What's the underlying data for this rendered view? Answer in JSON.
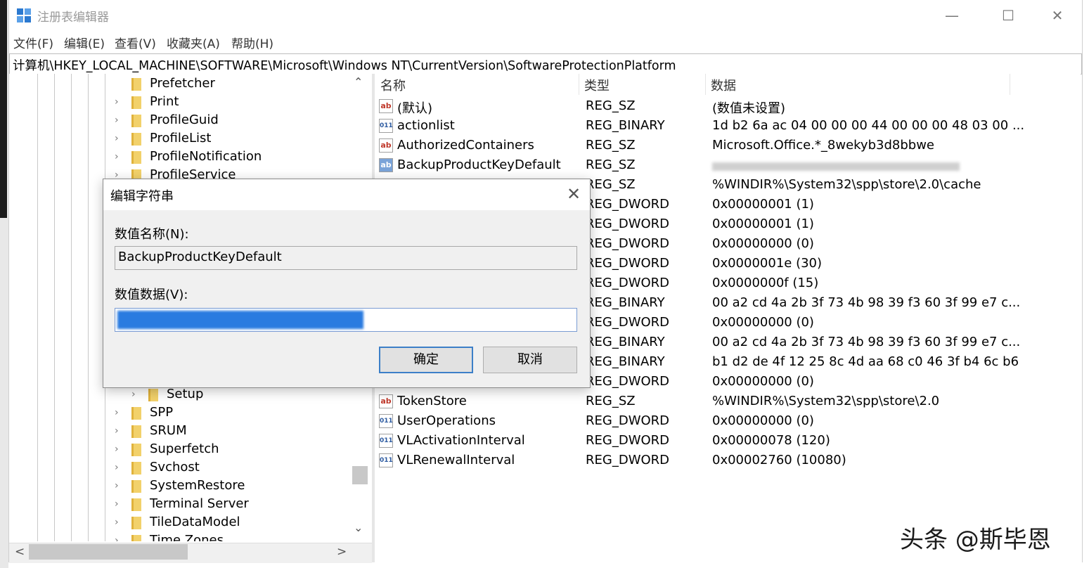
{
  "window": {
    "title": "注册表编辑器",
    "minimize_glyph": "—",
    "maximize_glyph": "☐",
    "close_glyph": "✕"
  },
  "menu": [
    "文件(F)",
    "编辑(E)",
    "查看(V)",
    "收藏夹(A)",
    "帮助(H)"
  ],
  "address": "计算机\\HKEY_LOCAL_MACHINE\\SOFTWARE\\Microsoft\\Windows NT\\CurrentVersion\\SoftwareProtectionPlatform",
  "tree": {
    "items": [
      {
        "label": "Prefetcher",
        "expander": ""
      },
      {
        "label": "Print",
        "expander": "›"
      },
      {
        "label": "ProfileGuid",
        "expander": "›"
      },
      {
        "label": "ProfileList",
        "expander": "›"
      },
      {
        "label": "ProfileNotification",
        "expander": "›"
      },
      {
        "label": "ProfileService",
        "expander": "›"
      }
    ],
    "lower_items": [
      {
        "label": "Setup",
        "expander": "›",
        "indent": 1
      },
      {
        "label": "SPP",
        "expander": "›",
        "indent": 0
      },
      {
        "label": "SRUM",
        "expander": "›",
        "indent": 0
      },
      {
        "label": "Superfetch",
        "expander": "›",
        "indent": 0
      },
      {
        "label": "Svchost",
        "expander": "›",
        "indent": 0
      },
      {
        "label": "SystemRestore",
        "expander": "›",
        "indent": 0
      },
      {
        "label": "Terminal Server",
        "expander": "›",
        "indent": 0
      },
      {
        "label": "TileDataModel",
        "expander": "›",
        "indent": 0
      },
      {
        "label": "Time Zones",
        "expander": "›",
        "indent": 0
      }
    ],
    "scroll_up": "⌃",
    "scroll_down": "⌄",
    "scroll_left": "<",
    "scroll_right": ">"
  },
  "list": {
    "headers": {
      "name": "名称",
      "type": "类型",
      "data": "数据"
    },
    "rows": [
      {
        "icon": "ab",
        "name": "(默认)",
        "type": "REG_SZ",
        "data": "(数值未设置)"
      },
      {
        "icon": "bin",
        "name": "actionlist",
        "type": "REG_BINARY",
        "data": "1d b2 6a ac 04 00 00 00 44 00 00 00 48 03 00 ..."
      },
      {
        "icon": "ab",
        "name": "AuthorizedContainers",
        "type": "REG_SZ",
        "data": "Microsoft.Office.*_8wekyb3d8bbwe"
      },
      {
        "icon": "sel",
        "name": "BackupProductKeyDefault",
        "type": "REG_SZ",
        "data": ""
      },
      {
        "icon": "",
        "name": "",
        "type": "REG_SZ",
        "data": "%WINDIR%\\System32\\spp\\store\\2.0\\cache"
      },
      {
        "icon": "",
        "name": "",
        "type": "REG_DWORD",
        "data": "0x00000001 (1)"
      },
      {
        "icon": "",
        "name": "",
        "type": "REG_DWORD",
        "data": "0x00000001 (1)"
      },
      {
        "icon": "",
        "name": "",
        "type": "REG_DWORD",
        "data": "0x00000000 (0)"
      },
      {
        "icon": "",
        "name": "",
        "type": "REG_DWORD",
        "data": "0x0000001e (30)"
      },
      {
        "icon": "",
        "name": "",
        "type": "REG_DWORD",
        "data": "0x0000000f (15)"
      },
      {
        "icon": "",
        "name": "",
        "type": "REG_BINARY",
        "data": "00 a2 cd 4a 2b 3f 73 4b 98 39 f3 60 3f 99 e7 c..."
      },
      {
        "icon": "",
        "name": "",
        "type": "REG_DWORD",
        "data": "0x00000000 (0)"
      },
      {
        "icon": "",
        "name": "",
        "type": "REG_BINARY",
        "data": "00 a2 cd 4a 2b 3f 73 4b 98 39 f3 60 3f 99 e7 c..."
      },
      {
        "icon": "",
        "name": "",
        "type": "REG_BINARY",
        "data": "b1 d2 de 4f 12 25 8c 4d aa 68 c0 46 3f b4 6c b6"
      },
      {
        "icon": "",
        "name": "",
        "type": "REG_DWORD",
        "data": "0x00000000 (0)"
      },
      {
        "icon": "ab",
        "name": "TokenStore",
        "type": "REG_SZ",
        "data": "%WINDIR%\\System32\\spp\\store\\2.0"
      },
      {
        "icon": "bin",
        "name": "UserOperations",
        "type": "REG_DWORD",
        "data": "0x00000000 (0)"
      },
      {
        "icon": "bin",
        "name": "VLActivationInterval",
        "type": "REG_DWORD",
        "data": "0x00000078 (120)"
      },
      {
        "icon": "bin",
        "name": "VLRenewalInterval",
        "type": "REG_DWORD",
        "data": "0x00002760 (10080)"
      }
    ]
  },
  "dialog": {
    "title": "编辑字符串",
    "close_glyph": "✕",
    "name_label": "数值名称(N):",
    "name_value": "BackupProductKeyDefault",
    "data_label": "数值数据(V):",
    "data_value": "",
    "ok": "确定",
    "cancel": "取消"
  },
  "watermark": "头条 @斯毕恩"
}
